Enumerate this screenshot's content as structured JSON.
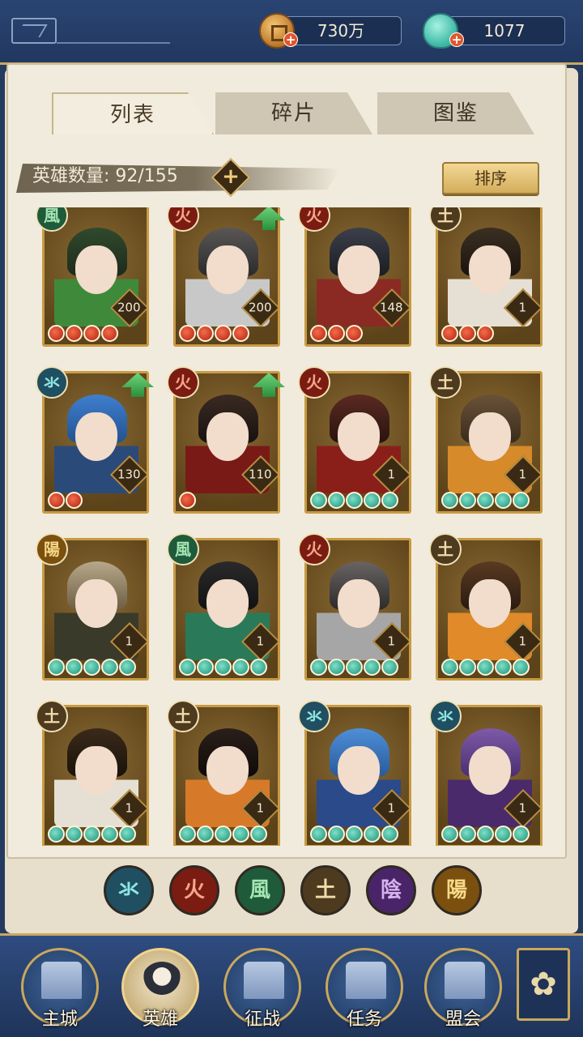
{
  "resources": {
    "coins": "730万",
    "jade": "1077"
  },
  "tabs": [
    {
      "label": "列表",
      "active": true
    },
    {
      "label": "碎片",
      "active": false
    },
    {
      "label": "图鉴",
      "active": false
    }
  ],
  "hero_count_label": "英雄数量: 92/155",
  "sort_label": "排序",
  "elements": {
    "water": "氺",
    "fire": "火",
    "wind": "風",
    "earth": "土",
    "yin": "陰",
    "yang": "陽"
  },
  "heroes": [
    {
      "element": "wind",
      "level": "200",
      "stars": 4,
      "star_color": "red",
      "upgrade": false
    },
    {
      "element": "fire",
      "level": "200",
      "stars": 4,
      "star_color": "red",
      "upgrade": true
    },
    {
      "element": "fire",
      "level": "148",
      "stars": 3,
      "star_color": "red",
      "upgrade": false
    },
    {
      "element": "earth",
      "level": "1",
      "stars": 3,
      "star_color": "red",
      "upgrade": false
    },
    {
      "element": "water",
      "level": "130",
      "stars": 2,
      "star_color": "red",
      "upgrade": true
    },
    {
      "element": "fire",
      "level": "110",
      "stars": 1,
      "star_color": "red",
      "upgrade": true
    },
    {
      "element": "fire",
      "level": "1",
      "stars": 5,
      "star_color": "green",
      "upgrade": false
    },
    {
      "element": "earth",
      "level": "1",
      "stars": 5,
      "star_color": "green",
      "upgrade": false
    },
    {
      "element": "yang",
      "level": "1",
      "stars": 5,
      "star_color": "green",
      "upgrade": false
    },
    {
      "element": "wind",
      "level": "1",
      "stars": 5,
      "star_color": "green",
      "upgrade": false
    },
    {
      "element": "fire",
      "level": "1",
      "stars": 5,
      "star_color": "green",
      "upgrade": false
    },
    {
      "element": "earth",
      "level": "1",
      "stars": 5,
      "star_color": "green",
      "upgrade": false
    },
    {
      "element": "earth",
      "level": "1",
      "stars": 5,
      "star_color": "green",
      "upgrade": false
    },
    {
      "element": "earth",
      "level": "1",
      "stars": 5,
      "star_color": "green",
      "upgrade": false
    },
    {
      "element": "water",
      "level": "1",
      "stars": 5,
      "star_color": "green",
      "upgrade": false
    },
    {
      "element": "water",
      "level": "1",
      "stars": 5,
      "star_color": "green",
      "upgrade": false
    }
  ],
  "filters": [
    "water",
    "fire",
    "wind",
    "earth",
    "yin",
    "yang"
  ],
  "nav": [
    {
      "label": "主城",
      "icon": "city-gate-icon",
      "active": false
    },
    {
      "label": "英雄",
      "icon": "hero-portrait-icon",
      "active": true
    },
    {
      "label": "征战",
      "icon": "battle-horn-icon",
      "active": false
    },
    {
      "label": "任务",
      "icon": "scroll-icon",
      "active": false
    },
    {
      "label": "盟会",
      "icon": "pavilion-icon",
      "active": false
    }
  ],
  "colors": {
    "gold_border": "#c89a44",
    "panel": "#f1ebdd",
    "navbar": "#1f3459",
    "sort_button": "#d3ad5c"
  }
}
